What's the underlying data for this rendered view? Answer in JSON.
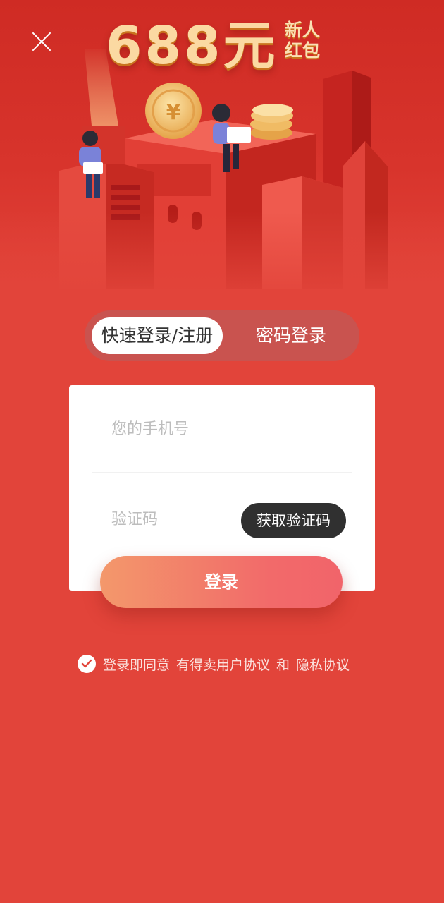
{
  "promo": {
    "amount": "688元",
    "tag_line1": "新人",
    "tag_line2": "红包"
  },
  "tabs": {
    "quick_login": "快速登录/注册",
    "password_login": "密码登录"
  },
  "form": {
    "phone_placeholder": "您的手机号",
    "code_placeholder": "验证码",
    "get_code_label": "获取验证码"
  },
  "login_label": "登录",
  "agreement": {
    "prefix": "登录即同意",
    "user_agreement": "有得卖用户协议",
    "and": "和",
    "privacy_policy": "隐私协议",
    "checked": true
  },
  "icons": {
    "close": "close-icon",
    "check": "check-icon",
    "coin": "yuan-coin-icon"
  },
  "colors": {
    "background": "#e2443a",
    "button_dark": "#303030",
    "login_gradient_start": "#f3986b",
    "login_gradient_end": "#f1646a",
    "promo_gold": "#fbd9a2"
  }
}
